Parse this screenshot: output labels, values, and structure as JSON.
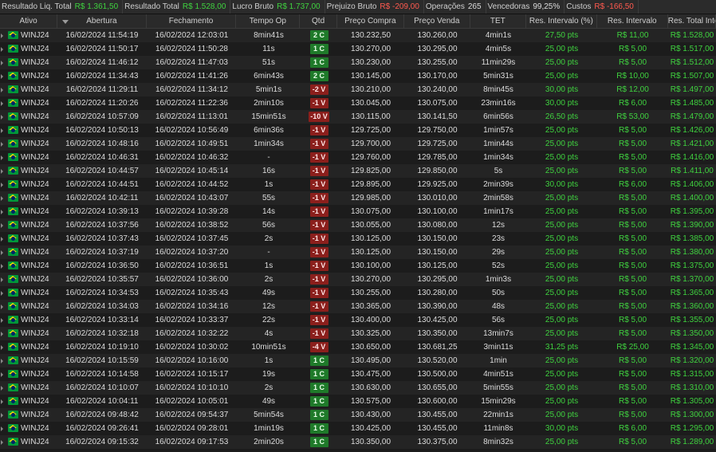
{
  "summary": [
    {
      "label": "Resultado Liq. Total",
      "value": "R$ 1.361,50",
      "tone": "pos"
    },
    {
      "label": "Resultado Total",
      "value": "R$ 1.528,00",
      "tone": "pos"
    },
    {
      "label": "Lucro Bruto",
      "value": "R$ 1.737,00",
      "tone": "pos"
    },
    {
      "label": "Prejuizo Bruto",
      "value": "R$ -209,00",
      "tone": "neg"
    },
    {
      "label": "Operações",
      "value": "265",
      "tone": ""
    },
    {
      "label": "Vencedoras",
      "value": "99,25%",
      "tone": ""
    },
    {
      "label": "Custos",
      "value": "R$ -166,50",
      "tone": "neg"
    }
  ],
  "columns": [
    "Ativo",
    "Abertura",
    "Fechamento",
    "Tempo Op",
    "Qtd",
    "Preço Compra",
    "Preço Venda",
    "TET",
    "Res. Intervalo (%)",
    "Res. Intervalo",
    "Res. Total Intervalo"
  ],
  "rows": [
    [
      "WINJ24",
      "16/02/2024 11:54:19",
      "16/02/2024 12:03:01",
      "8min41s",
      "2 C",
      "130.232,50",
      "130.260,00",
      "4min1s",
      "27,50 pts",
      "R$ 11,00",
      "R$ 1.528,00"
    ],
    [
      "WINJ24",
      "16/02/2024 11:50:17",
      "16/02/2024 11:50:28",
      "11s",
      "1 C",
      "130.270,00",
      "130.295,00",
      "4min5s",
      "25,00 pts",
      "R$ 5,00",
      "R$ 1.517,00"
    ],
    [
      "WINJ24",
      "16/02/2024 11:46:12",
      "16/02/2024 11:47:03",
      "51s",
      "1 C",
      "130.230,00",
      "130.255,00",
      "11min29s",
      "25,00 pts",
      "R$ 5,00",
      "R$ 1.512,00"
    ],
    [
      "WINJ24",
      "16/02/2024 11:34:43",
      "16/02/2024 11:41:26",
      "6min43s",
      "2 C",
      "130.145,00",
      "130.170,00",
      "5min31s",
      "25,00 pts",
      "R$ 10,00",
      "R$ 1.507,00"
    ],
    [
      "WINJ24",
      "16/02/2024 11:29:11",
      "16/02/2024 11:34:12",
      "5min1s",
      "-2 V",
      "130.210,00",
      "130.240,00",
      "8min45s",
      "30,00 pts",
      "R$ 12,00",
      "R$ 1.497,00"
    ],
    [
      "WINJ24",
      "16/02/2024 11:20:26",
      "16/02/2024 11:22:36",
      "2min10s",
      "-1 V",
      "130.045,00",
      "130.075,00",
      "23min16s",
      "30,00 pts",
      "R$ 6,00",
      "R$ 1.485,00"
    ],
    [
      "WINJ24",
      "16/02/2024 10:57:09",
      "16/02/2024 11:13:01",
      "15min51s",
      "-10 V",
      "130.115,00",
      "130.141,50",
      "6min56s",
      "26,50 pts",
      "R$ 53,00",
      "R$ 1.479,00"
    ],
    [
      "WINJ24",
      "16/02/2024 10:50:13",
      "16/02/2024 10:56:49",
      "6min36s",
      "-1 V",
      "129.725,00",
      "129.750,00",
      "1min57s",
      "25,00 pts",
      "R$ 5,00",
      "R$ 1.426,00"
    ],
    [
      "WINJ24",
      "16/02/2024 10:48:16",
      "16/02/2024 10:49:51",
      "1min34s",
      "-1 V",
      "129.700,00",
      "129.725,00",
      "1min44s",
      "25,00 pts",
      "R$ 5,00",
      "R$ 1.421,00"
    ],
    [
      "WINJ24",
      "16/02/2024 10:46:31",
      "16/02/2024 10:46:32",
      "-",
      "-1 V",
      "129.760,00",
      "129.785,00",
      "1min34s",
      "25,00 pts",
      "R$ 5,00",
      "R$ 1.416,00"
    ],
    [
      "WINJ24",
      "16/02/2024 10:44:57",
      "16/02/2024 10:45:14",
      "16s",
      "-1 V",
      "129.825,00",
      "129.850,00",
      "5s",
      "25,00 pts",
      "R$ 5,00",
      "R$ 1.411,00"
    ],
    [
      "WINJ24",
      "16/02/2024 10:44:51",
      "16/02/2024 10:44:52",
      "1s",
      "-1 V",
      "129.895,00",
      "129.925,00",
      "2min39s",
      "30,00 pts",
      "R$ 6,00",
      "R$ 1.406,00"
    ],
    [
      "WINJ24",
      "16/02/2024 10:42:11",
      "16/02/2024 10:43:07",
      "55s",
      "-1 V",
      "129.985,00",
      "130.010,00",
      "2min58s",
      "25,00 pts",
      "R$ 5,00",
      "R$ 1.400,00"
    ],
    [
      "WINJ24",
      "16/02/2024 10:39:13",
      "16/02/2024 10:39:28",
      "14s",
      "-1 V",
      "130.075,00",
      "130.100,00",
      "1min17s",
      "25,00 pts",
      "R$ 5,00",
      "R$ 1.395,00"
    ],
    [
      "WINJ24",
      "16/02/2024 10:37:56",
      "16/02/2024 10:38:52",
      "56s",
      "-1 V",
      "130.055,00",
      "130.080,00",
      "12s",
      "25,00 pts",
      "R$ 5,00",
      "R$ 1.390,00"
    ],
    [
      "WINJ24",
      "16/02/2024 10:37:43",
      "16/02/2024 10:37:45",
      "2s",
      "-1 V",
      "130.125,00",
      "130.150,00",
      "23s",
      "25,00 pts",
      "R$ 5,00",
      "R$ 1.385,00"
    ],
    [
      "WINJ24",
      "16/02/2024 10:37:19",
      "16/02/2024 10:37:20",
      "-",
      "-1 V",
      "130.125,00",
      "130.150,00",
      "29s",
      "25,00 pts",
      "R$ 5,00",
      "R$ 1.380,00"
    ],
    [
      "WINJ24",
      "16/02/2024 10:36:50",
      "16/02/2024 10:36:51",
      "1s",
      "-1 V",
      "130.100,00",
      "130.125,00",
      "52s",
      "25,00 pts",
      "R$ 5,00",
      "R$ 1.375,00"
    ],
    [
      "WINJ24",
      "16/02/2024 10:35:57",
      "16/02/2024 10:36:00",
      "2s",
      "-1 V",
      "130.270,00",
      "130.295,00",
      "1min3s",
      "25,00 pts",
      "R$ 5,00",
      "R$ 1.370,00"
    ],
    [
      "WINJ24",
      "16/02/2024 10:34:53",
      "16/02/2024 10:35:43",
      "49s",
      "-1 V",
      "130.255,00",
      "130.280,00",
      "50s",
      "25,00 pts",
      "R$ 5,00",
      "R$ 1.365,00"
    ],
    [
      "WINJ24",
      "16/02/2024 10:34:03",
      "16/02/2024 10:34:16",
      "12s",
      "-1 V",
      "130.365,00",
      "130.390,00",
      "48s",
      "25,00 pts",
      "R$ 5,00",
      "R$ 1.360,00"
    ],
    [
      "WINJ24",
      "16/02/2024 10:33:14",
      "16/02/2024 10:33:37",
      "22s",
      "-1 V",
      "130.400,00",
      "130.425,00",
      "56s",
      "25,00 pts",
      "R$ 5,00",
      "R$ 1.355,00"
    ],
    [
      "WINJ24",
      "16/02/2024 10:32:18",
      "16/02/2024 10:32:22",
      "4s",
      "-1 V",
      "130.325,00",
      "130.350,00",
      "13min7s",
      "25,00 pts",
      "R$ 5,00",
      "R$ 1.350,00"
    ],
    [
      "WINJ24",
      "16/02/2024 10:19:10",
      "16/02/2024 10:30:02",
      "10min51s",
      "-4 V",
      "130.650,00",
      "130.681,25",
      "3min11s",
      "31,25 pts",
      "R$ 25,00",
      "R$ 1.345,00"
    ],
    [
      "WINJ24",
      "16/02/2024 10:15:59",
      "16/02/2024 10:16:00",
      "1s",
      "1 C",
      "130.495,00",
      "130.520,00",
      "1min",
      "25,00 pts",
      "R$ 5,00",
      "R$ 1.320,00"
    ],
    [
      "WINJ24",
      "16/02/2024 10:14:58",
      "16/02/2024 10:15:17",
      "19s",
      "1 C",
      "130.475,00",
      "130.500,00",
      "4min51s",
      "25,00 pts",
      "R$ 5,00",
      "R$ 1.315,00"
    ],
    [
      "WINJ24",
      "16/02/2024 10:10:07",
      "16/02/2024 10:10:10",
      "2s",
      "1 C",
      "130.630,00",
      "130.655,00",
      "5min55s",
      "25,00 pts",
      "R$ 5,00",
      "R$ 1.310,00"
    ],
    [
      "WINJ24",
      "16/02/2024 10:04:11",
      "16/02/2024 10:05:01",
      "49s",
      "1 C",
      "130.575,00",
      "130.600,00",
      "15min29s",
      "25,00 pts",
      "R$ 5,00",
      "R$ 1.305,00"
    ],
    [
      "WINJ24",
      "16/02/2024 09:48:42",
      "16/02/2024 09:54:37",
      "5min54s",
      "1 C",
      "130.430,00",
      "130.455,00",
      "22min1s",
      "25,00 pts",
      "R$ 5,00",
      "R$ 1.300,00"
    ],
    [
      "WINJ24",
      "16/02/2024 09:26:41",
      "16/02/2024 09:28:01",
      "1min19s",
      "1 C",
      "130.425,00",
      "130.455,00",
      "11min8s",
      "30,00 pts",
      "R$ 6,00",
      "R$ 1.295,00"
    ],
    [
      "WINJ24",
      "16/02/2024 09:15:32",
      "16/02/2024 09:17:53",
      "2min20s",
      "1 C",
      "130.350,00",
      "130.375,00",
      "8min32s",
      "25,00 pts",
      "R$ 5,00",
      "R$ 1.289,00"
    ]
  ],
  "colors": {
    "positive": "#3fd23f",
    "negative": "#ff5a4f",
    "buy_badge": "#1f7a2a",
    "sell_badge": "#8b1f1c"
  },
  "icons": {
    "flag": "brazil-flag-icon",
    "row_arrow": "row-expand-arrow-icon",
    "sort": "sort-desc-icon"
  }
}
